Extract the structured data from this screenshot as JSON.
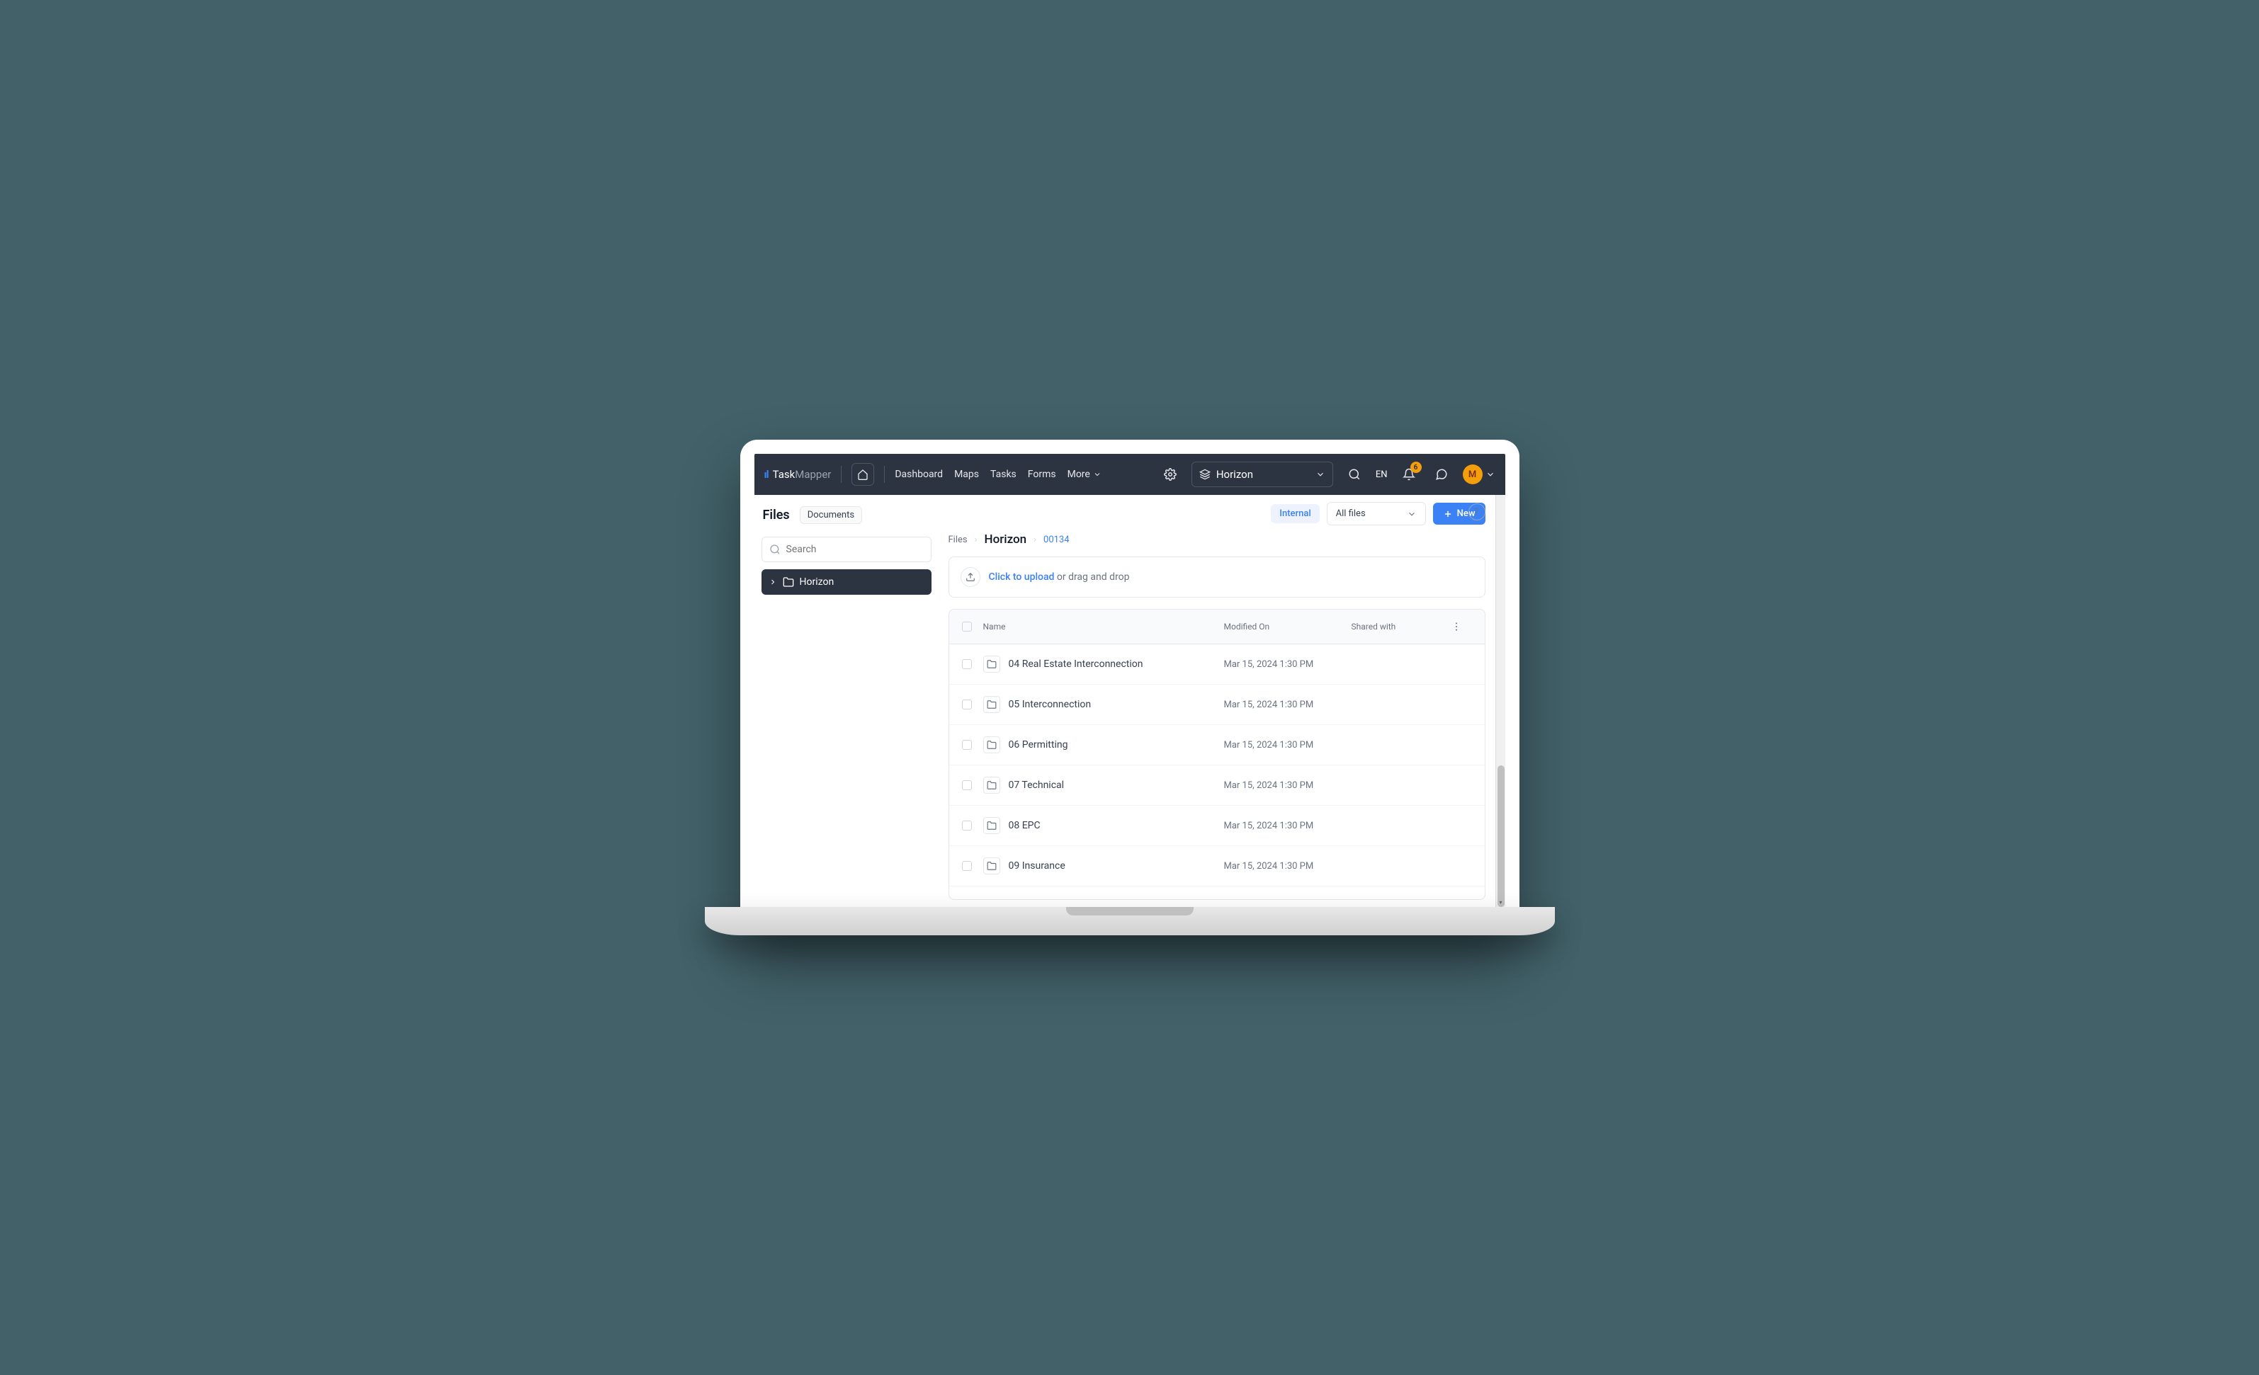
{
  "brand": {
    "task": "Task",
    "mapper": "Mapper"
  },
  "nav": {
    "dashboard": "Dashboard",
    "maps": "Maps",
    "tasks": "Tasks",
    "forms": "Forms",
    "more": "More"
  },
  "header": {
    "project_selected": "Horizon",
    "language": "EN",
    "notification_count": "6",
    "avatar_initial": "M"
  },
  "sidebar": {
    "title": "Files",
    "documents_label": "Documents",
    "search_placeholder": "Search",
    "tree": {
      "root": "Horizon"
    }
  },
  "toolbar": {
    "internal_label": "Internal",
    "filter_label": "All files",
    "new_label": "New",
    "help_tooltip": "?"
  },
  "breadcrumb": {
    "root": "Files",
    "project": "Horizon",
    "id": "00134"
  },
  "upload": {
    "link_text": "Click to upload",
    "rest_text": " or drag and drop"
  },
  "table": {
    "headers": {
      "name": "Name",
      "modified": "Modified On",
      "shared": "Shared with"
    },
    "rows": [
      {
        "name": "04 Real Estate Interconnection",
        "modified": "Mar 15, 2024 1:30 PM"
      },
      {
        "name": "05 Interconnection",
        "modified": "Mar 15, 2024 1:30 PM"
      },
      {
        "name": "06 Permitting",
        "modified": "Mar 15, 2024 1:30 PM"
      },
      {
        "name": "07 Technical",
        "modified": "Mar 15, 2024 1:30 PM"
      },
      {
        "name": "08 EPC",
        "modified": "Mar 15, 2024 1:30 PM"
      },
      {
        "name": "09 Insurance",
        "modified": "Mar 15, 2024 1:30 PM"
      }
    ]
  }
}
